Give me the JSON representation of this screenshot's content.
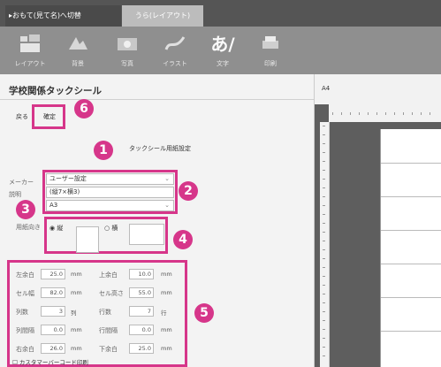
{
  "tabs": [
    {
      "label": "▸おもて(見て名)へ切替"
    },
    {
      "label": "うら(レイアウト)"
    }
  ],
  "toolbar": [
    {
      "label": "レイアウト",
      "icon": "layout-icon"
    },
    {
      "label": "背景",
      "icon": "background-icon"
    },
    {
      "label": "写真",
      "icon": "photo-icon"
    },
    {
      "label": "イラスト",
      "icon": "illustration-icon"
    },
    {
      "label": "文字",
      "icon": "text-icon",
      "glyph": "あ/"
    },
    {
      "label": "印刷",
      "icon": "print-icon"
    }
  ],
  "panel": {
    "title": "学校関係タックシール",
    "back_label": "戻る",
    "confirm_label": "確定",
    "section_title": "タックシール用紙設定",
    "maker_label": "メーカー",
    "maker_value": "ユーザー設定",
    "desc_label": "説明",
    "desc_value": "(縦7×横3)",
    "paper_label": "",
    "paper_value": "A3",
    "orientation_label": "用紙向き",
    "orientation_portrait": "縦",
    "orientation_landscape": "横"
  },
  "params": [
    {
      "label": "左余白",
      "value": "25.0",
      "unit": "mm",
      "label2": "上余白",
      "value2": "10.0",
      "unit2": "mm"
    },
    {
      "label": "セル幅",
      "value": "82.0",
      "unit": "mm",
      "label2": "セル高さ",
      "value2": "55.0",
      "unit2": "mm"
    },
    {
      "label": "列数",
      "value": "3",
      "unit": "列",
      "label2": "行数",
      "value2": "7",
      "unit2": "行"
    },
    {
      "label": "列間隔",
      "value": "0.0",
      "unit": "mm",
      "label2": "行間隔",
      "value2": "0.0",
      "unit2": "mm"
    },
    {
      "label": "右余白",
      "value": "26.0",
      "unit": "mm",
      "label2": "下余白",
      "value2": "25.0",
      "unit2": "mm"
    }
  ],
  "custom_print_label": "カスタマーバーコード印刷",
  "preview": {
    "paper_size": "A4"
  },
  "badges": [
    "1",
    "2",
    "3",
    "4",
    "5",
    "6"
  ],
  "colors": {
    "highlight": "#d6368a",
    "toolbar": "#8f8f8f",
    "tabbar": "#555555"
  }
}
